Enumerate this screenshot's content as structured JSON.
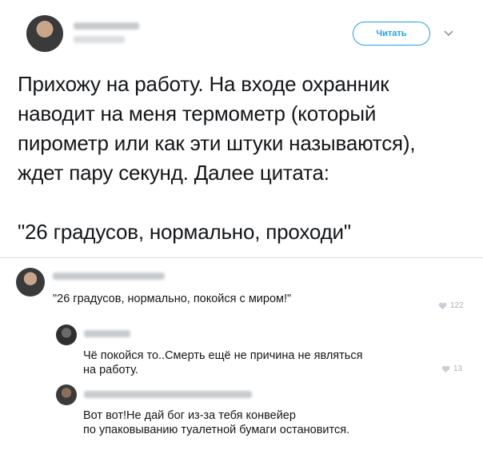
{
  "header": {
    "follow_label": "Читать",
    "menu_icon": "chevron-down-icon"
  },
  "tweet": {
    "lines": [
      "Прихожу на работу. На входе охранник",
      "наводит на меня термометр (который",
      "пирометр или как эти штуки называются),",
      "ждет пару секунд. Далее цитата:",
      "",
      "\"26 градусов, нормально, проходи\""
    ]
  },
  "comments": [
    {
      "text_lines": [
        "\"26 градусов, нормально, покойся с миром!\""
      ],
      "likes": "122"
    },
    {
      "text_lines": [
        "Чё покойся то..Смерть ещё не причина не являться",
        "на работу."
      ],
      "likes": "13"
    },
    {
      "text_lines": [
        "Вот вот!Не дай бог из-за тебя конвейер",
        "по упаковыванию туалетной бумаги остановится."
      ],
      "likes": ""
    }
  ],
  "colors": {
    "accent": "#1da1f2",
    "text": "#14171a",
    "muted": "#a8b2bb"
  }
}
